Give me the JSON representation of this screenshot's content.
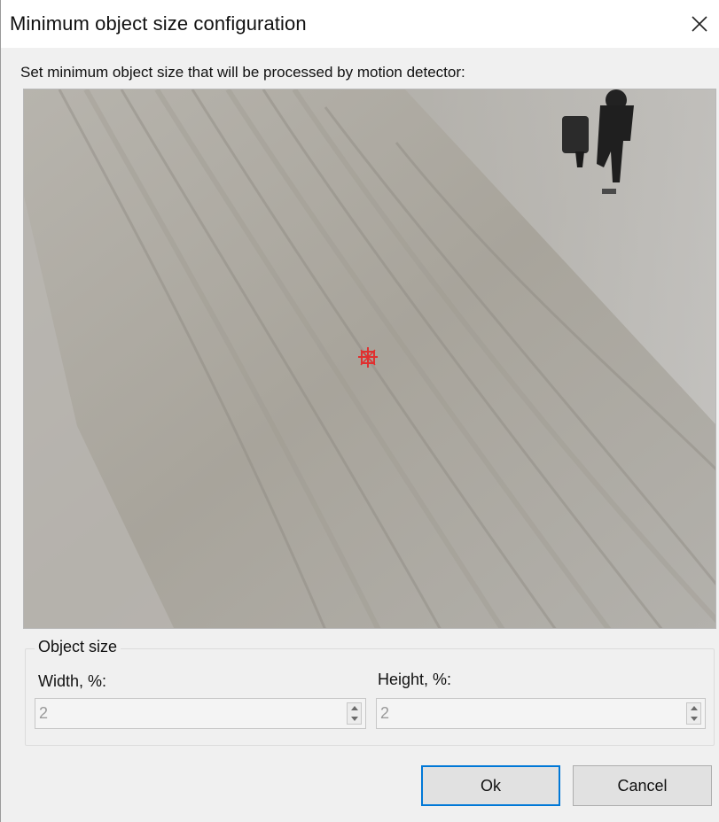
{
  "window": {
    "title": "Minimum object size configuration",
    "close_icon": "close-icon"
  },
  "instruction": "Set minimum object size that will be processed by motion detector:",
  "preview": {
    "description_marker": "red object-size marker",
    "marker_color": "#e03030"
  },
  "object_size": {
    "legend": "Object size",
    "width_label": "Width, %:",
    "width_value": "2",
    "height_label": "Height, %:",
    "height_value": "2"
  },
  "buttons": {
    "ok": "Ok",
    "cancel": "Cancel"
  },
  "colors": {
    "accent": "#0078d7",
    "dialog_bg": "#f0f0f0"
  }
}
